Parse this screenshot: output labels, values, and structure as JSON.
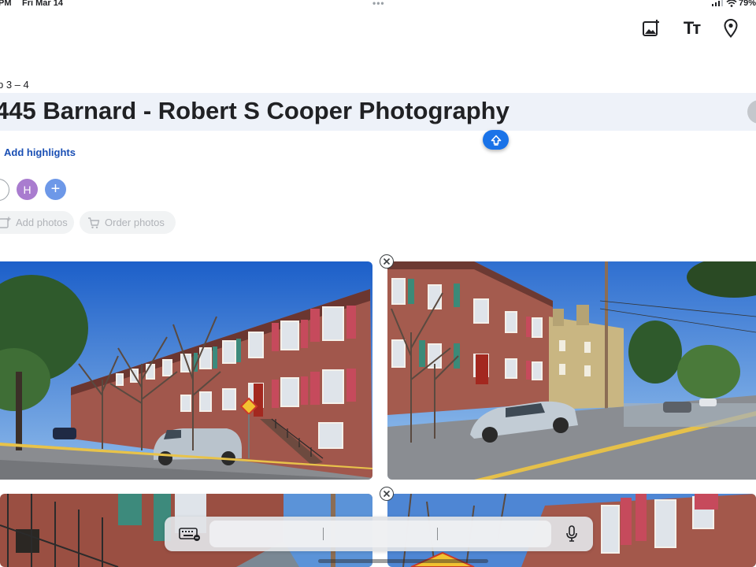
{
  "status_bar": {
    "time": "PM",
    "date": "Fri Mar 14",
    "multitask_indicator": "•••",
    "battery": "79%"
  },
  "toolbar": {
    "add_image_icon": "add-image-icon",
    "text_format_label": "Tт",
    "location_icon": "location-pin-icon"
  },
  "trip": {
    "date_range": "b 3 – 4",
    "title": "445 Barnard - Robert S Cooper Photography",
    "add_highlights": "Add highlights"
  },
  "collaborators": {
    "avatar_initial": "H",
    "add_label": "+"
  },
  "actions": {
    "add_photos": "Add photos",
    "order_photos": "Order photos"
  },
  "photos": [
    {
      "subject": "brick rowhouses with red shutters, street corner"
    },
    {
      "subject": "brick rowhouses and street with parked SUV"
    },
    {
      "subject": "brick facade with green shutters and iron railing"
    },
    {
      "subject": "brick building with red shutters"
    }
  ],
  "keyboard_bar": {
    "keyboard_icon": "keyboard-icon",
    "mic_icon": "microphone-icon"
  },
  "colors": {
    "accent": "#1a73e8",
    "title_background": "#eef2f9",
    "avatar": "#a97ccf",
    "add_person": "#6d98e8"
  }
}
